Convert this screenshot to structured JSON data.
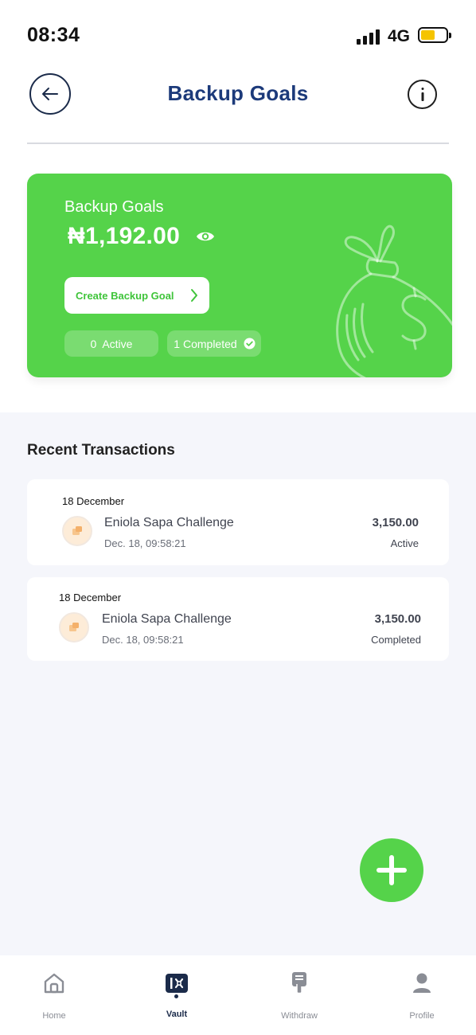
{
  "status_bar": {
    "time": "08:34",
    "network": "4G",
    "battery_level": 0.55
  },
  "header": {
    "title": "Backup Goals",
    "back_icon": "arrow-left-icon",
    "info_icon": "info-icon"
  },
  "goal_card": {
    "label": "Backup Goals",
    "amount": "₦1,192.00",
    "create_button": "Create Backup Goal",
    "active_pill": "0  Active",
    "completed_pill": "1 Completed",
    "background_color": "#55d34a"
  },
  "recent": {
    "title": "Recent Transactions",
    "items": [
      {
        "date": "18 December",
        "name": "Eniola Sapa Challenge",
        "time": "Dec. 18, 09:58:21",
        "amount": "3,150.00",
        "status": "Active"
      },
      {
        "date": "18 December",
        "name": "Eniola Sapa Challenge",
        "time": "Dec. 18, 09:58:21",
        "amount": "3,150.00",
        "status": "Completed"
      }
    ]
  },
  "fab": {
    "icon": "plus-icon"
  },
  "nav": {
    "items": [
      {
        "label": "Home",
        "icon": "home-icon"
      },
      {
        "label": "Vault",
        "icon": "vault-icon",
        "active": true
      },
      {
        "label": "Withdraw",
        "icon": "withdraw-icon"
      },
      {
        "label": "Profile",
        "icon": "profile-icon"
      }
    ]
  }
}
